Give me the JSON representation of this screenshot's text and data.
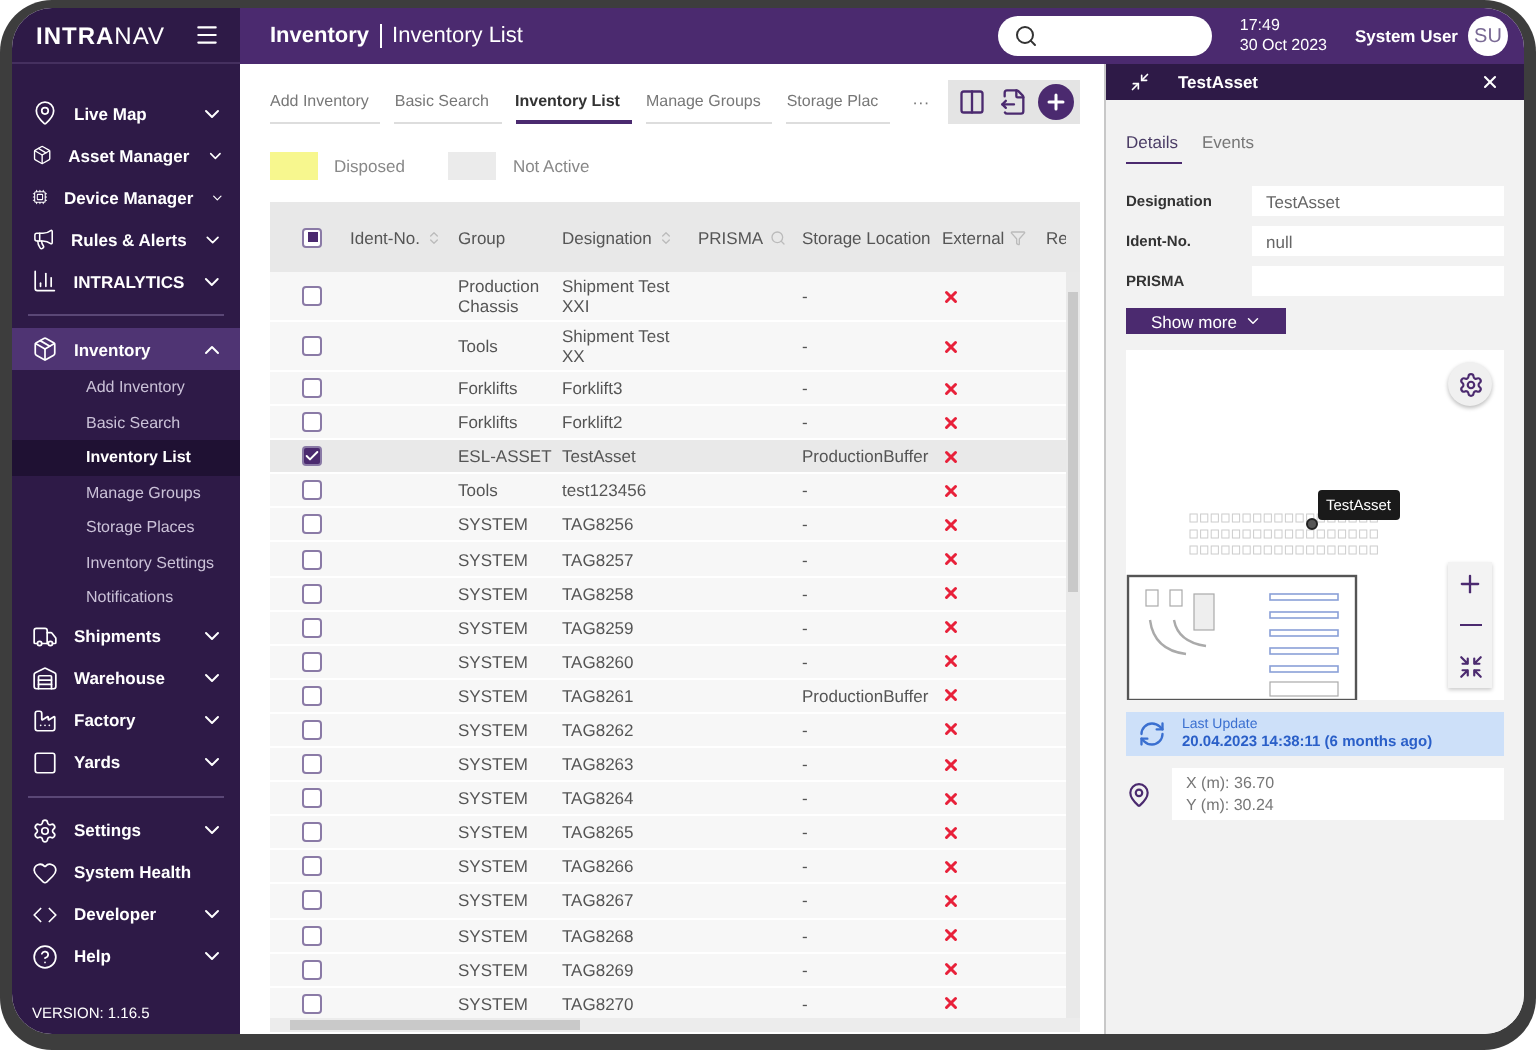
{
  "sidebar": {
    "logo": "**INTRA**NAV",
    "groups": [
      {
        "items": [
          {
            "label": "Live Map",
            "expanded": false
          },
          {
            "label": "Asset Manager",
            "expanded": false
          },
          {
            "label": "Device Manager",
            "expanded": false
          },
          {
            "label": "Rules & Alerts",
            "expanded": false
          },
          {
            "label": "INTRALYTICS",
            "expanded": false
          }
        ]
      },
      {
        "items": [
          {
            "label": "Inventory",
            "expanded": true,
            "children": [
              {
                "label": "Add Inventory",
                "selected": false
              },
              {
                "label": "Basic Search",
                "selected": false
              },
              {
                "label": "Inventory List",
                "selected": true
              },
              {
                "label": "Manage Groups",
                "selected": false
              },
              {
                "label": "Storage Places",
                "selected": false
              },
              {
                "label": "Inventory Settings",
                "selected": false
              },
              {
                "label": "Notifications",
                "selected": false
              }
            ]
          },
          {
            "label": "Shipments",
            "expanded": false
          },
          {
            "label": "Warehouse",
            "expanded": false
          },
          {
            "label": "Factory",
            "expanded": false
          },
          {
            "label": "Yards",
            "expanded": false
          }
        ]
      },
      {
        "items": [
          {
            "label": "Settings",
            "expanded": false
          },
          {
            "label": "System Health"
          },
          {
            "label": "Developer",
            "expanded": false
          },
          {
            "label": "Help",
            "expanded": false
          }
        ]
      }
    ],
    "version": "VERSION: 1.16.5"
  },
  "header": {
    "section": "Inventory",
    "page": "Inventory List",
    "time": "17:49",
    "date": "30 Oct 2023",
    "user": "System User",
    "avatar": "SU"
  },
  "tabs": [
    {
      "label": "Add Inventory",
      "selected": false
    },
    {
      "label": "Basic Search",
      "selected": false
    },
    {
      "label": "Inventory List",
      "selected": true
    },
    {
      "label": "Manage Groups",
      "selected": false
    },
    {
      "label": "Storage Plac",
      "selected": false
    }
  ],
  "more_label": "···",
  "legend": [
    {
      "label": "Disposed",
      "color": "#f7f78e"
    },
    {
      "label": "Not Active",
      "color": "#ebebeb"
    }
  ],
  "table": {
    "some_checked": true,
    "columns": [
      {
        "label": "Ident-No.",
        "sortable": true,
        "searchable": false,
        "filterable": false
      },
      {
        "label": "Group",
        "sortable": false,
        "searchable": false,
        "filterable": false
      },
      {
        "label": "Designation",
        "sortable": true,
        "searchable": false,
        "filterable": false
      },
      {
        "label": "PRISMA",
        "sortable": false,
        "searchable": true,
        "filterable": false
      },
      {
        "label": "Storage Location",
        "sortable": false,
        "searchable": false,
        "filterable": false
      },
      {
        "label": "External",
        "sortable": false,
        "searchable": false,
        "filterable": true
      },
      {
        "label": "Re",
        "sortable": false,
        "searchable": false,
        "filterable": false
      }
    ],
    "rows": [
      {
        "checked": false,
        "group": "Production Chassis",
        "designation": "Shipment Test XXI",
        "storage_location": "-",
        "external": false
      },
      {
        "checked": false,
        "group": "Tools",
        "designation": "Shipment Test XX",
        "storage_location": "-",
        "external": false
      },
      {
        "checked": false,
        "group": "Forklifts",
        "designation": "Forklift3",
        "storage_location": "-",
        "external": false
      },
      {
        "checked": false,
        "group": "Forklifts",
        "designation": "Forklift2",
        "storage_location": "-",
        "external": false
      },
      {
        "checked": true,
        "group": "ESL-ASSET",
        "designation": "TestAsset",
        "storage_location": "ProductionBuffer",
        "external": false
      },
      {
        "checked": false,
        "group": "Tools",
        "designation": "test123456",
        "storage_location": "-",
        "external": false
      },
      {
        "checked": false,
        "group": "SYSTEM",
        "designation": "TAG8256",
        "storage_location": "-",
        "external": false
      },
      {
        "checked": false,
        "group": "SYSTEM",
        "designation": "TAG8257",
        "storage_location": "-",
        "external": false
      },
      {
        "checked": false,
        "group": "SYSTEM",
        "designation": "TAG8258",
        "storage_location": "-",
        "external": false
      },
      {
        "checked": false,
        "group": "SYSTEM",
        "designation": "TAG8259",
        "storage_location": "-",
        "external": false
      },
      {
        "checked": false,
        "group": "SYSTEM",
        "designation": "TAG8260",
        "storage_location": "-",
        "external": false
      },
      {
        "checked": false,
        "group": "SYSTEM",
        "designation": "TAG8261",
        "storage_location": "ProductionBuffer",
        "external": false
      },
      {
        "checked": false,
        "group": "SYSTEM",
        "designation": "TAG8262",
        "storage_location": "-",
        "external": false
      },
      {
        "checked": false,
        "group": "SYSTEM",
        "designation": "TAG8263",
        "storage_location": "-",
        "external": false
      },
      {
        "checked": false,
        "group": "SYSTEM",
        "designation": "TAG8264",
        "storage_location": "-",
        "external": false
      },
      {
        "checked": false,
        "group": "SYSTEM",
        "designation": "TAG8265",
        "storage_location": "-",
        "external": false
      },
      {
        "checked": false,
        "group": "SYSTEM",
        "designation": "TAG8266",
        "storage_location": "-",
        "external": false
      },
      {
        "checked": false,
        "group": "SYSTEM",
        "designation": "TAG8267",
        "storage_location": "-",
        "external": false
      },
      {
        "checked": false,
        "group": "SYSTEM",
        "designation": "TAG8268",
        "storage_location": "-",
        "external": false
      },
      {
        "checked": false,
        "group": "SYSTEM",
        "designation": "TAG8269",
        "storage_location": "-",
        "external": false
      },
      {
        "checked": false,
        "group": "SYSTEM",
        "designation": "TAG8270",
        "storage_location": "-",
        "external": false
      }
    ]
  },
  "detail": {
    "title": "TestAsset",
    "tabs": [
      {
        "label": "Details",
        "selected": true
      },
      {
        "label": "Events",
        "selected": false
      }
    ],
    "fields": [
      {
        "label": "Designation",
        "value": "TestAsset"
      },
      {
        "label": "Ident-No.",
        "value": "null"
      },
      {
        "label": "PRISMA"
      }
    ],
    "show_more": "Show more",
    "map": {
      "marker_label": "TestAsset"
    },
    "last_update": {
      "label": "Last Update",
      "value": "20.04.2023 14:38:11 (6 months ago)"
    },
    "position": [
      "X (m): 36.70",
      "Y (m): 30.24"
    ]
  }
}
